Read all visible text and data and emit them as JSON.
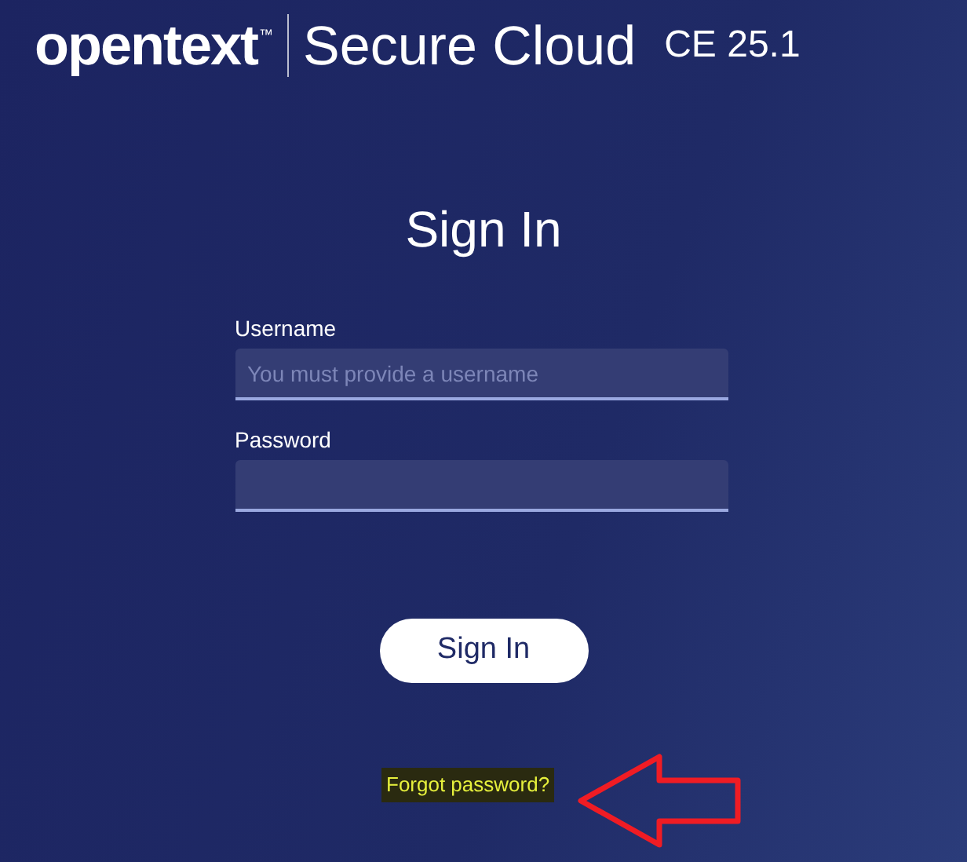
{
  "header": {
    "logo": "opentext",
    "trademark": "™",
    "product": "Secure Cloud",
    "version": "CE 25.1"
  },
  "title": "Sign In",
  "fields": [
    {
      "label": "Username",
      "placeholder": "You must provide a username"
    },
    {
      "label": "Password"
    }
  ],
  "button": "Sign In",
  "link": "Forgot password?",
  "annotation": {
    "kind": "arrow"
  }
}
